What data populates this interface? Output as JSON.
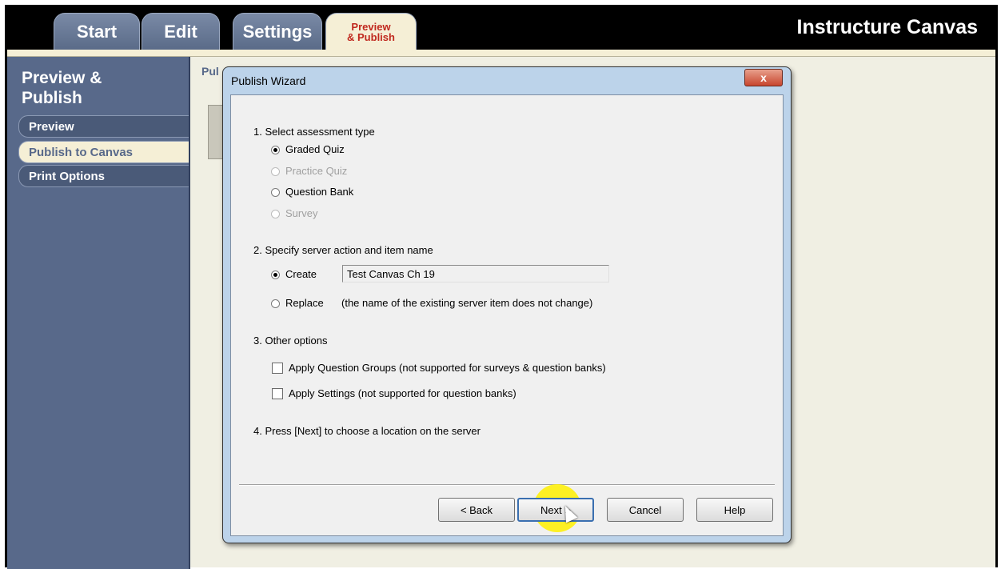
{
  "app": {
    "brand": "Instructure Canvas",
    "tabs": [
      {
        "label": "Start"
      },
      {
        "label": "Edit"
      },
      {
        "label": "Settings"
      },
      {
        "label_line1": "Preview",
        "label_line2": "& Publish"
      }
    ]
  },
  "sidebar": {
    "title_line1": "Preview &",
    "title_line2": "Publish",
    "items": [
      {
        "label": "Preview"
      },
      {
        "label": "Publish to Canvas"
      },
      {
        "label": "Print Options"
      }
    ]
  },
  "pane": {
    "label": "Pul"
  },
  "dialog": {
    "title": "Publish Wizard",
    "close_label": "x",
    "section1": {
      "heading": "1. Select assessment type",
      "options": [
        "Graded Quiz",
        "Practice Quiz",
        "Question Bank",
        "Survey"
      ],
      "selected": "Graded Quiz"
    },
    "section2": {
      "heading": "2. Specify server action and item name",
      "create_label": "Create",
      "item_name": "Test Canvas Ch 19",
      "replace_label": "Replace",
      "replace_note": "(the name of the existing server item does not change)"
    },
    "section3": {
      "heading": "3. Other options",
      "options": [
        "Apply Question Groups (not supported for surveys & question banks)",
        "Apply Settings (not supported for question banks)"
      ]
    },
    "section4": {
      "text": "4. Press [Next] to choose a location on the server"
    },
    "buttons": {
      "back": "< Back",
      "next": "Next >",
      "cancel": "Cancel",
      "help": "Help"
    }
  },
  "colors": {
    "sidebar": "#58698a",
    "titlebar": "#000000",
    "active_tab_text": "#c0281e",
    "dialog_frame": "#bcd3ea"
  }
}
